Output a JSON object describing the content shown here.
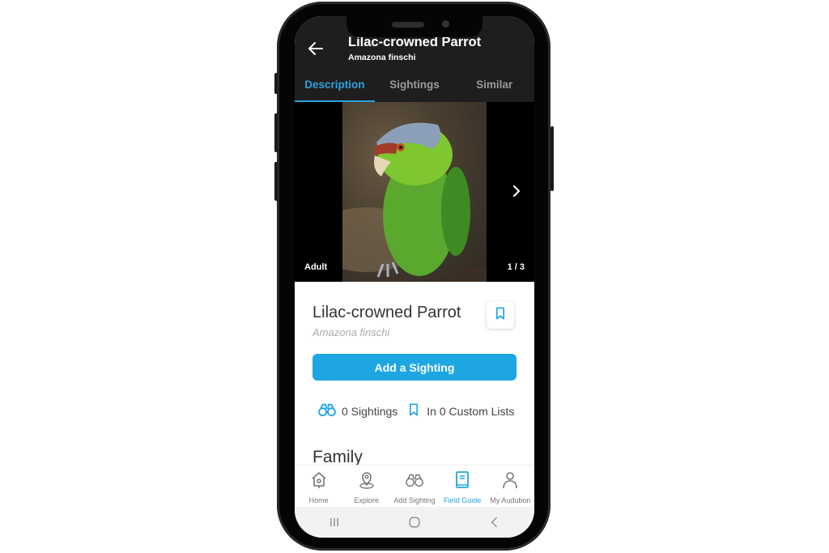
{
  "appbar": {
    "title": "Lilac-crowned Parrot",
    "subtitle": "Amazona finschi",
    "back_icon": "arrow-left-icon"
  },
  "tabs": [
    {
      "label": "Description",
      "active": true
    },
    {
      "label": "Sightings",
      "active": false
    },
    {
      "label": "Similar",
      "active": false
    }
  ],
  "gallery": {
    "caption": "Adult",
    "counter": "1 / 3",
    "current": 1,
    "total": 3,
    "next_icon": "chevron-right-icon",
    "image_alt": "Lilac-crowned Parrot photo"
  },
  "species": {
    "common_name": "Lilac-crowned Parrot",
    "scientific_name": "Amazona finschi",
    "bookmark_icon": "bookmark-icon"
  },
  "actions": {
    "add_sighting_label": "Add a Sighting"
  },
  "stats": {
    "sightings": "0 Sightings",
    "custom_lists": "In 0 Custom Lists"
  },
  "sections": {
    "family_heading": "Family"
  },
  "bottom_nav": [
    {
      "label": "Home",
      "icon": "birdhouse-icon",
      "active": false
    },
    {
      "label": "Explore",
      "icon": "map-pin-icon",
      "active": false
    },
    {
      "label": "Add Sighting",
      "icon": "binoculars-icon",
      "active": false
    },
    {
      "label": "Field Guide",
      "icon": "book-icon",
      "active": true
    },
    {
      "label": "My Audubon",
      "icon": "person-icon",
      "active": false
    }
  ],
  "colors": {
    "accent": "#1ea6e3",
    "appbar_bg": "#1e1e1e",
    "tab_inactive": "#9a9a9a"
  }
}
